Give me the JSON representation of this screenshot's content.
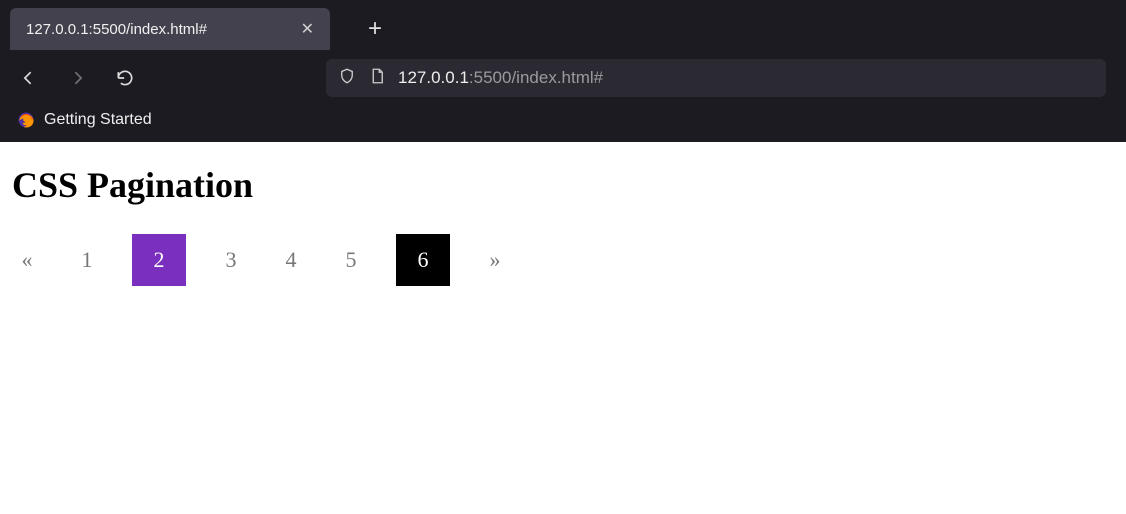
{
  "browser": {
    "tab_title": "127.0.0.1:5500/index.html#",
    "url_dim_prefix": "127.0.0.1",
    "url_dim_port": ":5500",
    "url_path": "/index.html#",
    "bookmark_label": "Getting Started"
  },
  "page": {
    "heading": "CSS Pagination",
    "pagination": {
      "prev": "«",
      "next": "»",
      "items": [
        "1",
        "2",
        "3",
        "4",
        "5",
        "6"
      ],
      "active_index": 1,
      "hover_index": 5
    }
  }
}
